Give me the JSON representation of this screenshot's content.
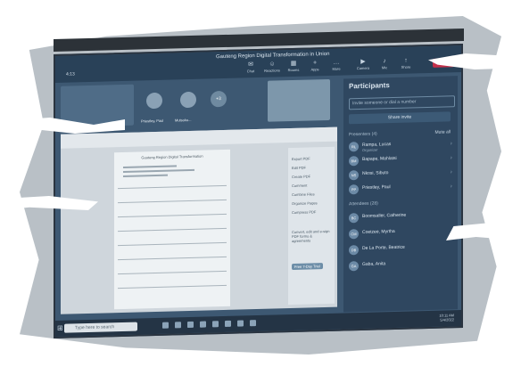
{
  "meeting": {
    "title": "Gauteng Region Digital Transformation in Union",
    "timer": "4:13",
    "toolbar": [
      {
        "label": "Chat",
        "glyph": "✉"
      },
      {
        "label": "Reactions",
        "glyph": "☺"
      },
      {
        "label": "Rooms",
        "glyph": "▦"
      },
      {
        "label": "Apps",
        "glyph": "+"
      },
      {
        "label": "More",
        "glyph": "…"
      },
      {
        "label": "Camera",
        "glyph": "▶"
      },
      {
        "label": "Mic",
        "glyph": "♪"
      },
      {
        "label": "Share",
        "glyph": "↑"
      }
    ],
    "leave_label": "Leave"
  },
  "tiles": [
    {
      "name": "Priestley, Paul"
    },
    {
      "name": "Mutsoko..."
    },
    {
      "name": "+3"
    }
  ],
  "participants": {
    "title": "Participants",
    "search_placeholder": "Invite someone or dial a number",
    "share_invite": "Share invite",
    "presenters_label": "Presenters (4)",
    "mute_all": "Mute all",
    "presenters": [
      {
        "name": "Rampa, Lucas",
        "sub": "Organizer",
        "initials": "RL"
      },
      {
        "name": "Bapape, Mahlatsi",
        "sub": "",
        "initials": "BM"
      },
      {
        "name": "Nkosi, Sibuto",
        "sub": "",
        "initials": "NS"
      },
      {
        "name": "Priestley, Paul",
        "sub": "",
        "initials": "PP"
      }
    ],
    "attendees_label": "Attendees (28)",
    "attendees": [
      {
        "name": "Boomsaller, Catherine",
        "initials": "BC"
      },
      {
        "name": "Coetzee, Myrtha",
        "initials": "CM"
      },
      {
        "name": "De La Porte, Beatrice",
        "initials": "DB"
      },
      {
        "name": "Gaba, Anita",
        "initials": "GA"
      }
    ]
  },
  "document": {
    "heading": "Gauteng Region Digital Transformation",
    "side_items": [
      "Export PDF",
      "Edit PDF",
      "Create PDF",
      "Comment",
      "Combine Files",
      "Organize Pages",
      "Compress PDF"
    ],
    "side_footer": "Convert, edit and e-sign PDF forms & agreements",
    "side_button": "Free 7-Day Trial"
  },
  "taskbar": {
    "search_placeholder": "Type here to search",
    "time": "10:11 AM",
    "date": "5/4/2022"
  }
}
